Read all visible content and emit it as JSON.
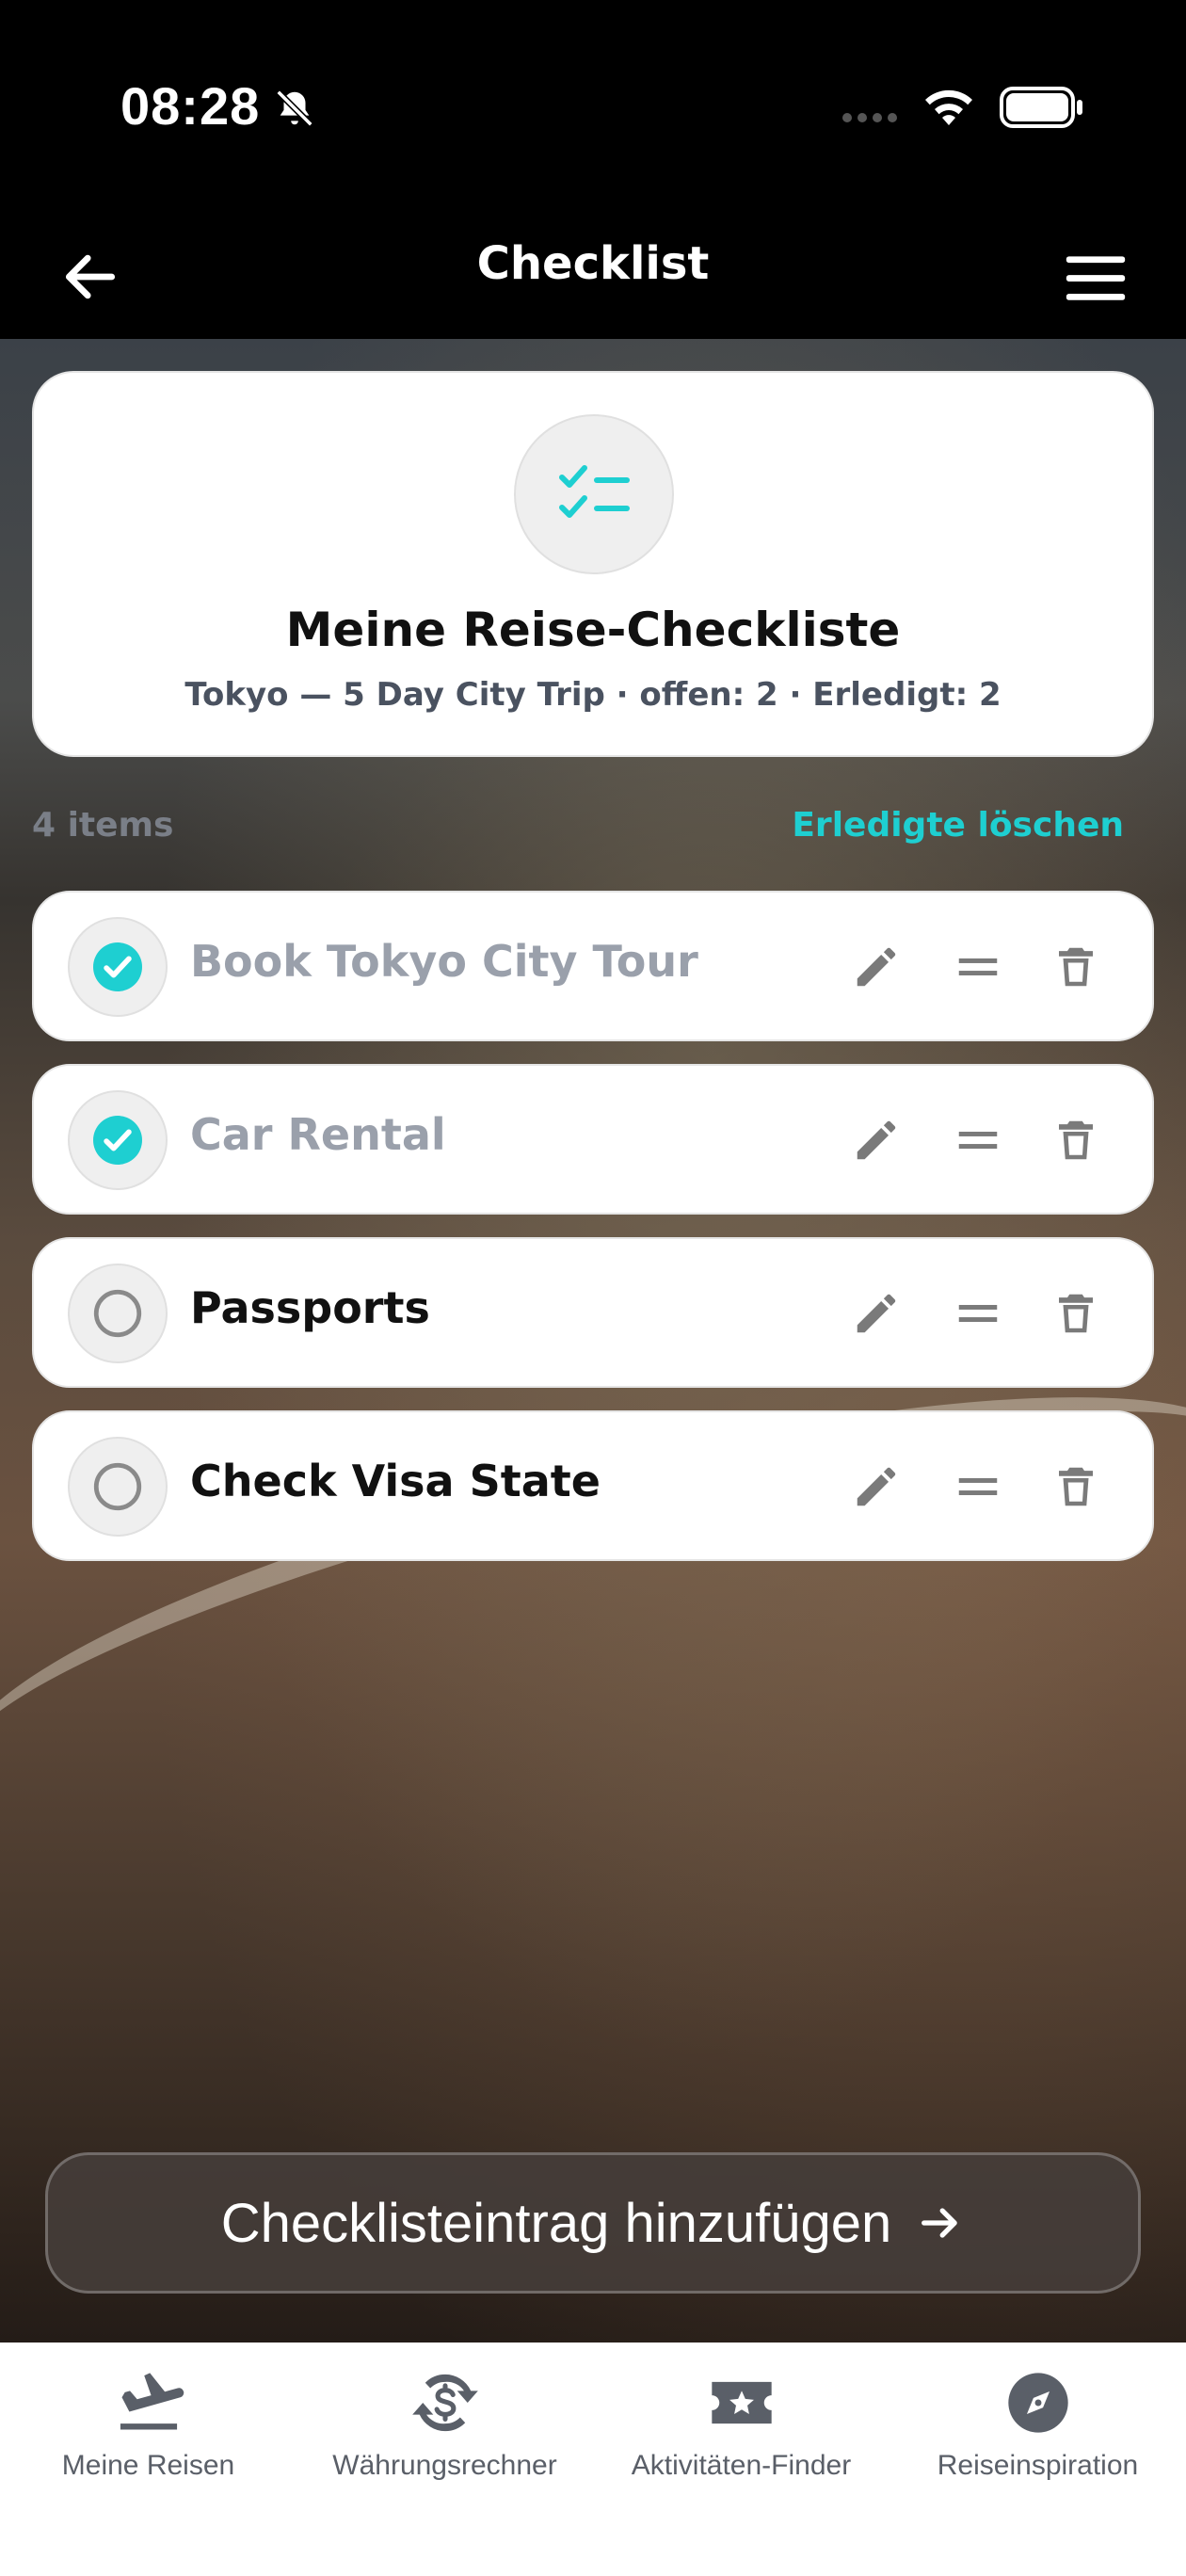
{
  "status": {
    "time": "08:28"
  },
  "nav": {
    "title": "Checklist"
  },
  "header": {
    "title": "Meine Reise-Checkliste",
    "subtitle": "Tokyo — 5 Day City Trip · offen: 2 · Erledigt: 2"
  },
  "list": {
    "count": "4 items",
    "clear_label": "Erledigte löschen",
    "items": [
      {
        "label": "Book Tokyo City Tour",
        "done": true
      },
      {
        "label": "Car Rental",
        "done": true
      },
      {
        "label": "Passports",
        "done": false
      },
      {
        "label": "Check Visa State",
        "done": false
      }
    ]
  },
  "add_button": {
    "label": "Checklisteintrag hinzufügen"
  },
  "tabs": [
    {
      "label": "Meine Reisen",
      "icon": "plane-landing-icon"
    },
    {
      "label": "Währungsrechner",
      "icon": "currency-exchange-icon"
    },
    {
      "label": "Aktivitäten-Finder",
      "icon": "ticket-star-icon"
    },
    {
      "label": "Reiseinspiration",
      "icon": "compass-icon"
    }
  ],
  "colors": {
    "accent": "#1ecfd1",
    "done_text": "#9aa0ab",
    "icon_gray": "#7a7a7a"
  }
}
